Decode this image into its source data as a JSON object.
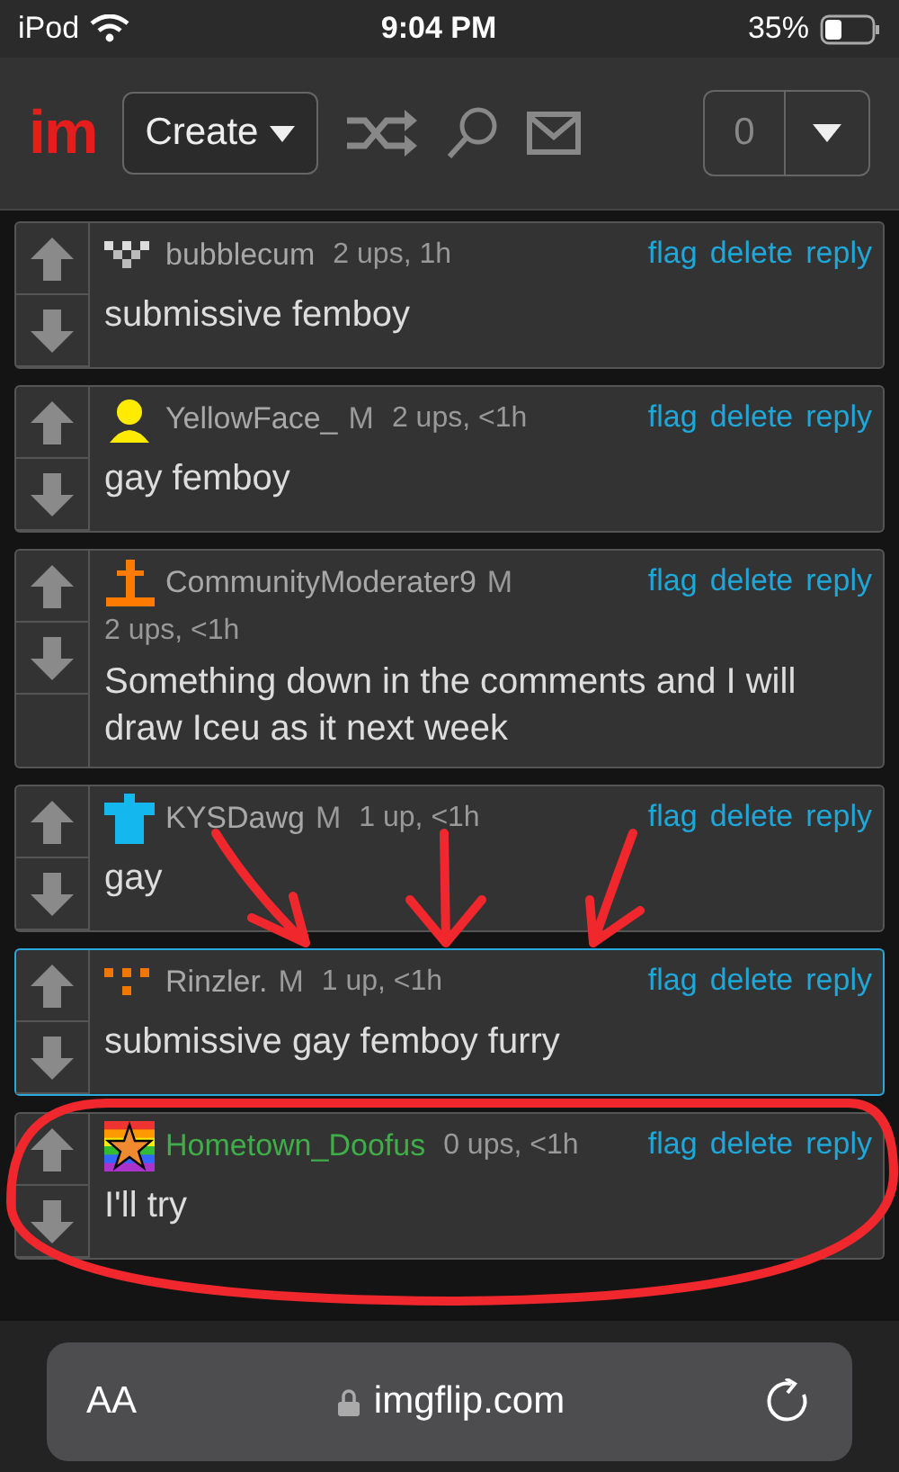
{
  "status_bar": {
    "device": "iPod",
    "time": "9:04 PM",
    "battery": "35%"
  },
  "header": {
    "logo": "im",
    "create_button": "Create",
    "notification_count": "0"
  },
  "comments": [
    {
      "kind": "checker",
      "username": "bubblecum",
      "color": "#a8a8a8",
      "meta": "2 ups, 1h",
      "text": "submissive femboy",
      "highlighted": false,
      "actions": [
        "flag",
        "delete",
        "reply"
      ]
    },
    {
      "kind": "person",
      "username": "YellowFace_",
      "color": "#a8a8a8",
      "badge": "M",
      "meta": "2 ups, <1h",
      "text": "gay femboy",
      "highlighted": false,
      "actions": [
        "flag",
        "delete",
        "reply"
      ]
    },
    {
      "kind": "cross",
      "username": "CommunityModerater9",
      "color": "#a8a8a8",
      "badge": "M",
      "meta": "2 ups, <1h",
      "text": "Something down in the comments and I will draw Iceu as it next week",
      "highlighted": false,
      "actions": [
        "flag",
        "delete",
        "reply"
      ]
    },
    {
      "kind": "shirt",
      "username": "KYSDawg",
      "color": "#a8a8a8",
      "badge": "M",
      "meta": "1 up, <1h",
      "text": "gay",
      "highlighted": false,
      "actions": [
        "flag",
        "delete",
        "reply"
      ]
    },
    {
      "kind": "dots",
      "username": "Rinzler.",
      "color": "#a8a8a8",
      "badge": "M",
      "meta": "1 up, <1h",
      "text": "submissive gay femboy furry",
      "highlighted": true,
      "actions": [
        "flag",
        "delete",
        "reply"
      ]
    },
    {
      "kind": "star",
      "username": "Hometown_Doofus",
      "color": "#3fae49",
      "meta": "0 ups, <1h",
      "text": "I'll try",
      "highlighted": false,
      "actions": [
        "flag",
        "delete",
        "reply"
      ]
    }
  ],
  "browser_bar": {
    "text_size": "AA",
    "url": "imgflip.com"
  }
}
